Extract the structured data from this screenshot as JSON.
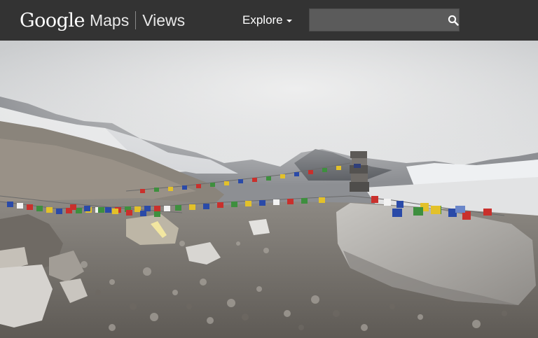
{
  "header": {
    "brand_google": "Google",
    "brand_maps": "Maps",
    "brand_views": "Views",
    "explore_label": "Explore",
    "search": {
      "value": "",
      "placeholder": ""
    },
    "icons": {
      "explore_dropdown": "caret-down-icon",
      "search": "search-icon"
    },
    "colors": {
      "bar_background": "#333333",
      "search_background": "#5b5b5b"
    }
  },
  "panorama": {
    "description_text": ""
  }
}
